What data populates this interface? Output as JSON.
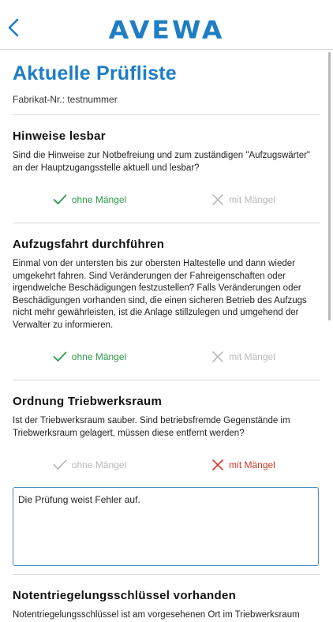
{
  "header": {
    "back_label": "Zurück",
    "logo_text": "AVEWA"
  },
  "page": {
    "title": "Aktuelle Prüfliste",
    "fabrikat_label": "Fabrikat-Nr.: testnummer"
  },
  "choice_labels": {
    "ok": "ohne Mängel",
    "bad": "mit Mängel"
  },
  "colors": {
    "brand": "#1f7dc4",
    "ok": "#2e9a4a",
    "bad": "#cc3b2b",
    "inactive": "#b9b9b9"
  },
  "sections": [
    {
      "title": "Hinweise lesbar",
      "text": "Sind die Hinweise zur Notbefreiung und zum zuständigen \"Aufzugswärter\" an der Hauptzugangsstelle aktuell und lesbar?",
      "selected": "ohne Mängel"
    },
    {
      "title": "Aufzugsfahrt durchführen",
      "text": "Einmal von der untersten bis zur obersten Haltestelle und dann wieder umgekehrt fahren. Sind Veränderungen der Fahreigenschaften oder irgendwelche Beschädigungen festzustellen? Falls Veränderungen oder Beschädigungen vorhanden sind, die einen sicheren Betrieb des Aufzugs nicht mehr gewährleisten, ist die Anlage stillzulegen und umgehend der Verwalter zu informieren.",
      "selected": "ohne Mängel"
    },
    {
      "title": "Ordnung Triebwerksraum",
      "text": "Ist der Triebwerksraum sauber. Sind betriebsfremde Gegenstände im Triebwerksraum gelagert, müssen diese entfernt werden?",
      "selected": "mit Mängel",
      "remark": "Die Prüfung weist Fehler auf."
    },
    {
      "title": "Notentriegelungsschlüssel vorhanden",
      "text": "Notentriegelungsschlüssel ist am vorgesehenen Ort im Triebwerksraum"
    }
  ]
}
